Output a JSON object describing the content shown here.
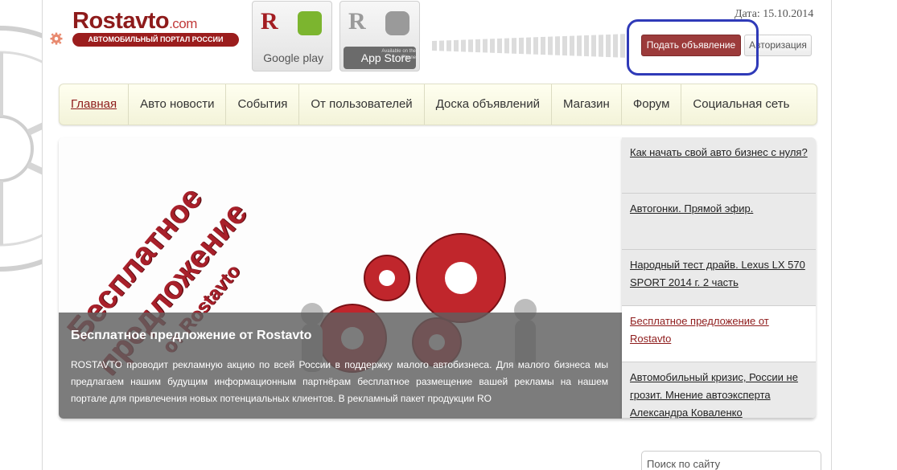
{
  "header": {
    "logo_name": "Rostavto",
    "logo_domain": ".com",
    "logo_tagline": "АВТОМОБИЛЬНЫЙ ПОРТАЛ РОССИИ",
    "google_play_label": "Google play",
    "app_store_label": "App Store",
    "app_store_small": "Available on the iPhone",
    "date": "Дата: 15.10.2014",
    "submit_ad_label": "Подать объявление",
    "auth_label": "Авторизация"
  },
  "nav": {
    "items": [
      {
        "label": "Главная",
        "active": true
      },
      {
        "label": "Авто новости"
      },
      {
        "label": "События"
      },
      {
        "label": "От пользователей"
      },
      {
        "label": "Доска объявлений"
      },
      {
        "label": "Магазин"
      },
      {
        "label": "Форум"
      },
      {
        "label": "Социальная сеть"
      }
    ]
  },
  "slider": {
    "promo_line1": "Бесплатное",
    "promo_line2": "предложение",
    "promo_line3": "от Rostavto",
    "caption_title": "Бесплатное предложение от Rostavto",
    "caption_body": "ROSTAVTO проводит рекламную акцию по всей России в поддержку малого автобизнеса. Для малого бизнеса мы предлагаем нашим будущим информационным партнёрам бесплатное размещение вашей рекламы на нашем портале для привлечения новых потенциальных клиентов. В рекламный пакет продукции RO"
  },
  "news": {
    "items": [
      {
        "label": "Как начать свой авто бизнес с нуля?"
      },
      {
        "label": "Автогонки. Прямой эфир."
      },
      {
        "label": "Народный тест драйв. Lexus LX 570 SPORT 2014 г. 2 часть"
      },
      {
        "label": "Бесплатное предложение от Rostavto",
        "active": true
      },
      {
        "label": "Автомобильный кризис, России не грозит. Мнение автоэксперта Александра Коваленко"
      }
    ]
  },
  "search": {
    "placeholder": "Поиск по сайту"
  },
  "colors": {
    "brand": "#8e1b1b",
    "submit_button": "#9c3b3b",
    "highlight": "#2f3ab8",
    "nav_bg": "#f3f3d9"
  }
}
